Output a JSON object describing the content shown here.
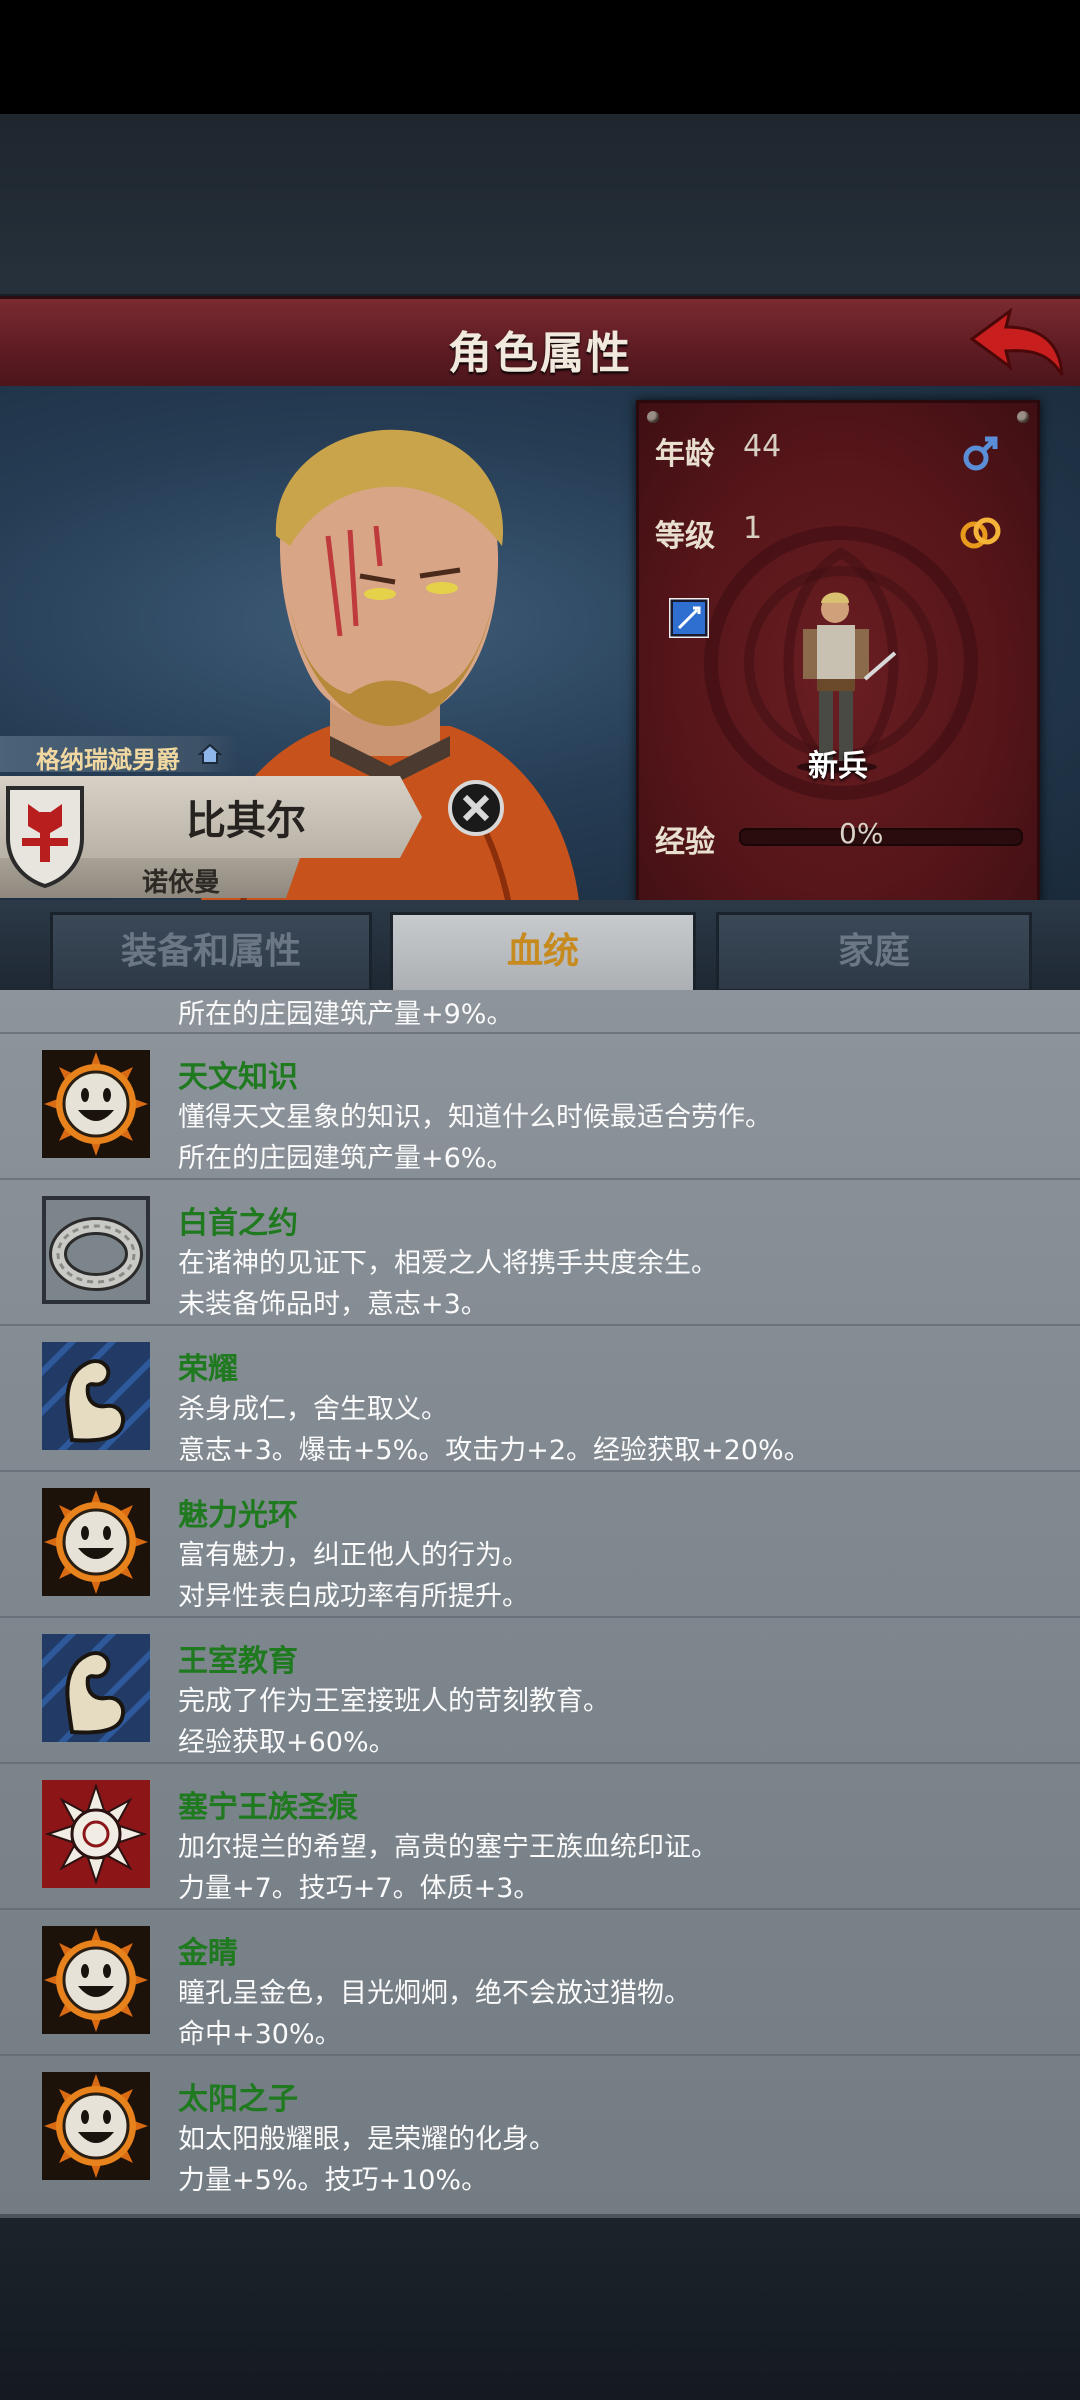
{
  "screen": {
    "title": "角色属性"
  },
  "character": {
    "title_tag": "格纳瑞斌男爵",
    "name": "比其尔",
    "house": "诺依曼",
    "age_label": "年龄",
    "age": "44",
    "level_label": "等级",
    "level": "1",
    "class_name": "新兵",
    "exp_label": "经验",
    "exp_value": "0%",
    "exp_fraction": 0
  },
  "tabs": [
    {
      "label": "装备和属性",
      "active": false
    },
    {
      "label": "血统",
      "active": true
    },
    {
      "label": "家庭",
      "active": false
    }
  ],
  "partial_trait": {
    "effect": "所在的庄园建筑产量+9%。",
    "icon": "smiley-sun-icon"
  },
  "traits": [
    {
      "name": "天文知识",
      "desc": "懂得天文星象的知识，知道什么时候最适合劳作。",
      "effect": "所在的庄园建筑产量+6%。",
      "icon": "smiley-sun-icon"
    },
    {
      "name": "白首之约",
      "desc": "在诸神的见证下，相爱之人将携手共度余生。",
      "effect": "未装备饰品时，意志+3。",
      "icon": "ring-icon"
    },
    {
      "name": "荣耀",
      "desc": "杀身成仁，舍生取义。",
      "effect": "意志+3。爆击+5%。攻击力+2。经验获取+20%。",
      "icon": "muscle-arm-icon"
    },
    {
      "name": "魅力光环",
      "desc": "富有魅力，纠正他人的行为。",
      "effect": "对异性表白成功率有所提升。",
      "icon": "smiley-sun-icon"
    },
    {
      "name": "王室教育",
      "desc": "完成了作为王室接班人的苛刻教育。",
      "effect": "经验获取+60%。",
      "icon": "muscle-arm-icon"
    },
    {
      "name": "塞宁王族圣痕",
      "desc": "加尔提兰的希望，高贵的塞宁王族血统印证。",
      "effect": "力量+7。技巧+7。体质+3。",
      "icon": "royal-sun-emblem-icon"
    },
    {
      "name": "金睛",
      "desc": "瞳孔呈金色，目光炯炯，绝不会放过猎物。",
      "effect": "命中+30%。",
      "icon": "smiley-sun-icon"
    },
    {
      "name": "太阳之子",
      "desc": "如太阳般耀眼，是荣耀的化身。",
      "effect": "力量+5%。技巧+10%。",
      "icon": "smiley-sun-icon"
    }
  ],
  "colors": {
    "trait_name": "#1f7a1f",
    "active_tab_text": "#c68a1f",
    "title_bar": "#6a2229"
  }
}
